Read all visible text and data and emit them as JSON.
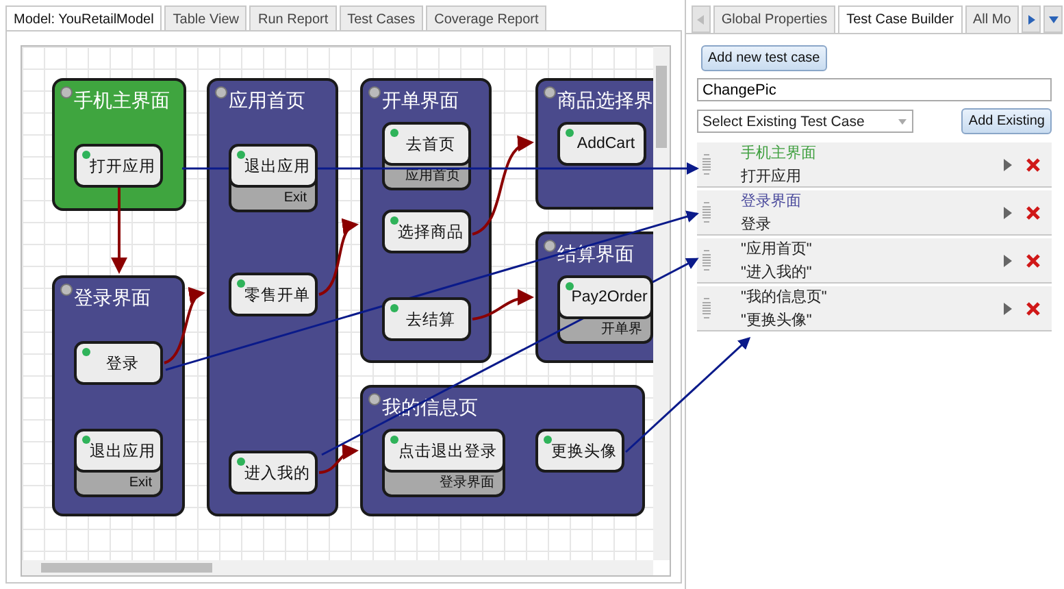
{
  "left_tabs": [
    {
      "label": "Model: YouRetailModel",
      "selected": true
    },
    {
      "label": "Table View",
      "selected": false
    },
    {
      "label": "Run Report",
      "selected": false
    },
    {
      "label": "Test Cases",
      "selected": false
    },
    {
      "label": "Coverage Report",
      "selected": false
    }
  ],
  "diagram": {
    "states": [
      {
        "name": "手机主界面",
        "color": "#3fa53f",
        "actions": [
          {
            "label": "打开应用"
          }
        ]
      },
      {
        "name": "应用首页",
        "color": "#4a4a8c",
        "actions": [
          {
            "label": "退出应用",
            "footer": "Exit"
          },
          {
            "label": "零售开单"
          },
          {
            "label": "进入我的"
          }
        ]
      },
      {
        "name": "开单界面",
        "color": "#4a4a8c",
        "actions": [
          {
            "label": "去首页",
            "footer": "应用首页"
          },
          {
            "label": "选择商品"
          },
          {
            "label": "去结算"
          }
        ]
      },
      {
        "name": "商品选择界",
        "color": "#4a4a8c",
        "actions": [
          {
            "label": "AddCart"
          }
        ]
      },
      {
        "name": "结算界面",
        "color": "#4a4a8c",
        "actions": [
          {
            "label": "Pay2Order",
            "footer": "开单界"
          }
        ]
      },
      {
        "name": "登录界面",
        "color": "#4a4a8c",
        "actions": [
          {
            "label": "登录"
          },
          {
            "label": "退出应用",
            "footer": "Exit"
          }
        ]
      },
      {
        "name": "我的信息页",
        "color": "#4a4a8c",
        "actions": [
          {
            "label": "点击退出登录",
            "footer": "登录界面"
          },
          {
            "label": "更换头像"
          }
        ]
      }
    ]
  },
  "right_tabs": [
    {
      "label": "Global Properties",
      "selected": false
    },
    {
      "label": "Test Case Builder",
      "selected": true
    },
    {
      "label": "All Mo",
      "selected": false
    }
  ],
  "add_button": "Add new test case",
  "name_field": {
    "value": "ChangePic"
  },
  "existing_select": {
    "value": "Select Existing Test Case"
  },
  "add_existing_button": "Add Existing",
  "steps": [
    {
      "state": "手机主界面",
      "action": "打开应用",
      "color": "#3f9f3f"
    },
    {
      "state": "登录界面",
      "action": "登录",
      "color": "#4a4a9c"
    },
    {
      "state": "\"应用首页\"",
      "action": "\"进入我的\"",
      "color": "#222222"
    },
    {
      "state": "\"我的信息页\"",
      "action": "\"更换头像\"",
      "color": "#222222"
    }
  ]
}
